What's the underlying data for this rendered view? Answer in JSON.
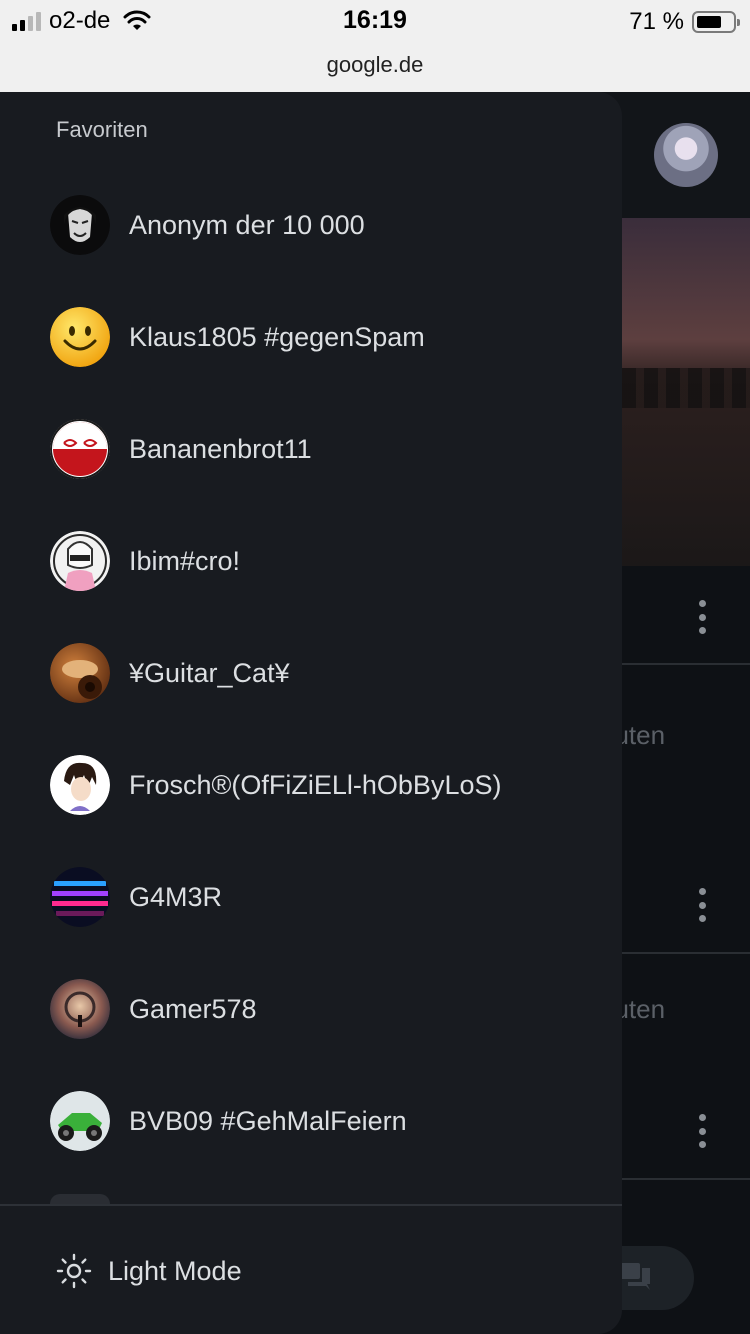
{
  "status_bar": {
    "carrier": "o2-de",
    "time": "16:19",
    "battery_text": "71 %",
    "battery_level": 0.71,
    "url": "google.de"
  },
  "background": {
    "partial_text_1": "nuten",
    "partial_text_2": "nuten"
  },
  "drawer": {
    "section_title": "Favoriten",
    "favorites": [
      {
        "name": "Anonym der 10 000"
      },
      {
        "name": "Klaus1805 #gegenSpam"
      },
      {
        "name": "Bananenbrot11"
      },
      {
        "name": "Ibim#cro!"
      },
      {
        "name": "¥Guitar_Cat¥"
      },
      {
        "name": "Frosch®(OfFiZiELl-hObByLoS)"
      },
      {
        "name": "G4M3R"
      },
      {
        "name": "Gamer578"
      },
      {
        "name": "BVB09 #GehMalFeiern"
      }
    ],
    "light_mode_label": "Light Mode"
  },
  "icons": {
    "signal": "signal-bars-icon",
    "wifi": "wifi-icon",
    "battery": "battery-icon",
    "sun": "sun-icon",
    "more": "more-vertical-icon",
    "chat": "chat-icon"
  }
}
